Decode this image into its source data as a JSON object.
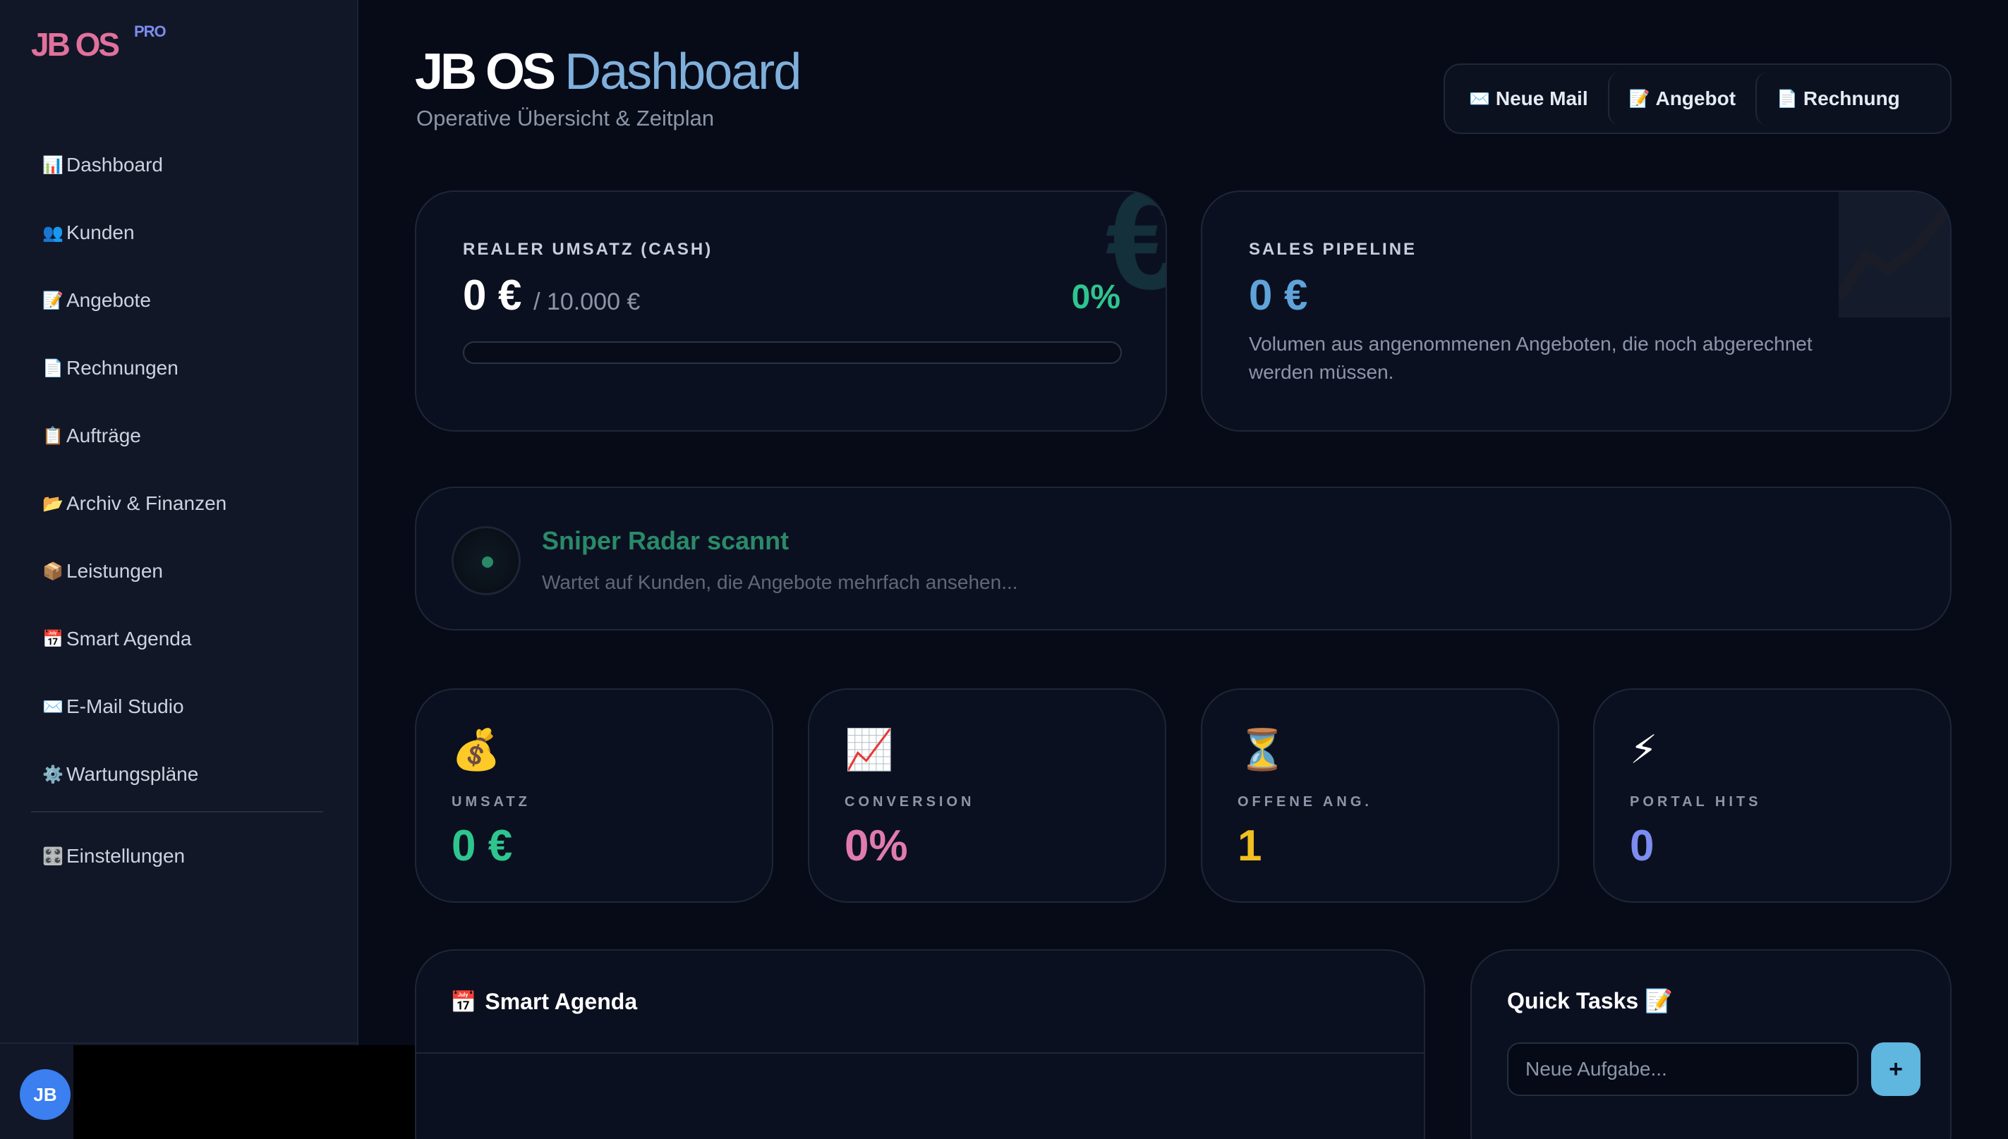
{
  "brand": {
    "name": "JB OS",
    "badge": "PRO"
  },
  "sidebar": {
    "items": [
      {
        "icon": "📊",
        "label": "Dashboard"
      },
      {
        "icon": "👥",
        "label": "Kunden"
      },
      {
        "icon": "📝",
        "label": "Angebote"
      },
      {
        "icon": "📄",
        "label": "Rechnungen"
      },
      {
        "icon": "📋",
        "label": "Aufträge"
      },
      {
        "icon": "📂",
        "label": "Archiv & Finanzen"
      },
      {
        "icon": "📦",
        "label": "Leistungen"
      },
      {
        "icon": "📅",
        "label": "Smart Agenda"
      },
      {
        "icon": "✉️",
        "label": "E-Mail Studio"
      },
      {
        "icon": "⚙️",
        "label": "Wartungspläne"
      }
    ],
    "settings": {
      "icon": "🎛️",
      "label": "Einstellungen"
    },
    "user": {
      "initials": "JB"
    }
  },
  "header": {
    "title_main": "JB OS",
    "title_accent": "Dashboard",
    "subtitle": "Operative Übersicht & Zeitplan"
  },
  "actions": [
    {
      "icon": "✉️",
      "label": "Neue Mail"
    },
    {
      "icon": "📝",
      "label": "Angebot"
    },
    {
      "icon": "📄",
      "label": "Rechnung"
    }
  ],
  "revenue": {
    "label": "REALER UMSATZ (CASH)",
    "value": "0 €",
    "goal": "/ 10.000 €",
    "percent": "0%",
    "progress": 0,
    "watermark": "€"
  },
  "pipeline": {
    "label": "SALES PIPELINE",
    "value": "0 €",
    "description": "Volumen aus angenommenen Angeboten, die noch abgerechnet werden müssen."
  },
  "radar": {
    "title": "Sniper Radar scannt",
    "subtitle": "Wartet auf Kunden, die Angebote mehrfach ansehen..."
  },
  "stats": [
    {
      "icon": "💰",
      "label": "UMSATZ",
      "value": "0 €",
      "color": "#2ec58f"
    },
    {
      "icon": "📈",
      "label": "CONVERSION",
      "value": "0%",
      "color": "#e07bb0"
    },
    {
      "icon": "⏳",
      "label": "OFFENE ANG.",
      "value": "1",
      "color": "#f0c020"
    },
    {
      "icon": "⚡",
      "label": "PORTAL HITS",
      "value": "0",
      "color": "#7d8cf0"
    }
  ],
  "agenda": {
    "icon": "📅",
    "title": "Smart Agenda"
  },
  "tasks": {
    "title": "Quick Tasks 📝",
    "placeholder": "Neue Aufgabe...",
    "add_label": "+"
  },
  "colors": {
    "background": "#070b18",
    "sidebar": "#111726",
    "accent_green": "#2ec58f",
    "accent_blue": "#5fa3da",
    "brand_pink": "#e0719c"
  }
}
